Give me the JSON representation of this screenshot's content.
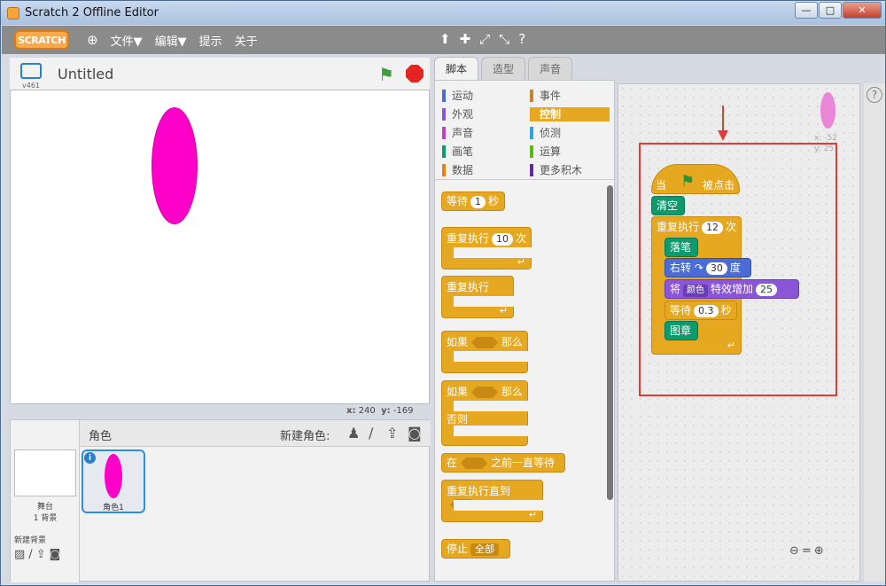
{
  "window": {
    "title": "Scratch 2 Offline Editor",
    "min": "—",
    "max": "□",
    "close": "✕"
  },
  "menu": {
    "logo": "SCRATCH",
    "items": [
      "文件▼",
      "编辑▼",
      "提示",
      "关于"
    ],
    "tools": [
      "⬆",
      "✚",
      "⤢",
      "⤡",
      "?"
    ]
  },
  "stage": {
    "version": "v461",
    "project_name": "Untitled",
    "coords": {
      "x_label": "x:",
      "x": "240",
      "y_label": "y:",
      "y": "-169"
    }
  },
  "sprites": {
    "header": "角色",
    "new_label": "新建角色:",
    "stage_label": "舞台",
    "stage_bg": "1 背景",
    "new_bg": "新建背景",
    "sprite_name": "角色1",
    "info": "i"
  },
  "tabs": [
    "脚本",
    "造型",
    "声音"
  ],
  "categories": [
    {
      "label": "运动",
      "color": "#4a6cd4"
    },
    {
      "label": "事件",
      "color": "#c88330"
    },
    {
      "label": "外观",
      "color": "#8a55d7"
    },
    {
      "label": "控制",
      "color": "#e6a821"
    },
    {
      "label": "声音",
      "color": "#bb42c3"
    },
    {
      "label": "侦测",
      "color": "#2ca5e2"
    },
    {
      "label": "画笔",
      "color": "#0e9a6c"
    },
    {
      "label": "运算",
      "color": "#5cb712"
    },
    {
      "label": "数据",
      "color": "#ee7d16"
    },
    {
      "label": "更多积木",
      "color": "#632d99"
    }
  ],
  "palette": {
    "wait": {
      "a": "等待",
      "v": "1",
      "b": "秒"
    },
    "repeat": {
      "a": "重复执行",
      "v": "10",
      "b": "次"
    },
    "forever": "重复执行",
    "if": {
      "a": "如果",
      "b": "那么"
    },
    "ifelse": {
      "a": "如果",
      "b": "那么",
      "c": "否则"
    },
    "waituntil": {
      "a": "在",
      "b": "之前一直等待"
    },
    "repeatuntil": "重复执行直到",
    "stop": {
      "a": "停止",
      "v": "全部"
    }
  },
  "script": {
    "hat": {
      "a": "当",
      "b": "被点击"
    },
    "clear": "清空",
    "repeat": {
      "a": "重复执行",
      "v": "12",
      "b": "次"
    },
    "pendown": "落笔",
    "turn": {
      "a": "右转",
      "v": "30",
      "b": "度"
    },
    "effect": {
      "a": "将",
      "v": "颜色",
      "b": "特效增加",
      "n": "25"
    },
    "wait": {
      "a": "等待",
      "v": "0.3",
      "b": "秒"
    },
    "stamp": "图章",
    "sprite_x": "x: -52",
    "sprite_y": "y: 25"
  }
}
